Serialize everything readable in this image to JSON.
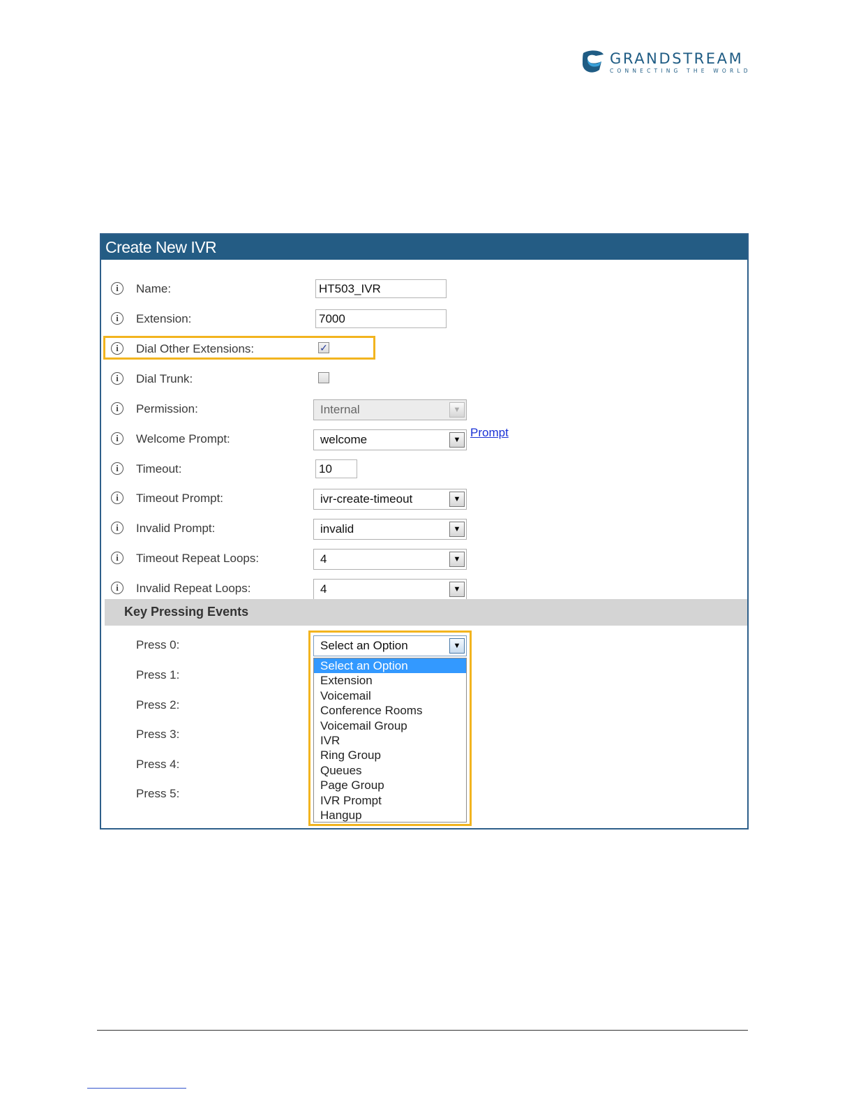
{
  "brand": {
    "name": "GRANDSTREAM",
    "tagline": "CONNECTING THE WORLD",
    "colors": {
      "primary": "#1f5c84",
      "accent": "#3aa0d8"
    }
  },
  "panel": {
    "title": "Create New IVR",
    "header_color": "#245c84",
    "highlight_color": "#f2b41f"
  },
  "fields": {
    "name": {
      "label": "Name:",
      "value": "HT503_IVR"
    },
    "extension": {
      "label": "Extension:",
      "value": "7000"
    },
    "dial_other_extensions": {
      "label": "Dial Other Extensions:",
      "checked": true,
      "mark": "✓"
    },
    "dial_trunk": {
      "label": "Dial Trunk:",
      "checked": false
    },
    "permission": {
      "label": "Permission:",
      "value": "Internal",
      "disabled": true
    },
    "welcome_prompt": {
      "label": "Welcome Prompt:",
      "value": "welcome",
      "link": "Prompt"
    },
    "timeout": {
      "label": "Timeout:",
      "value": "10"
    },
    "timeout_prompt": {
      "label": "Timeout Prompt:",
      "value": "ivr-create-timeout"
    },
    "invalid_prompt": {
      "label": "Invalid Prompt:",
      "value": "invalid"
    },
    "timeout_repeat_loops": {
      "label": "Timeout Repeat Loops:",
      "value": "4"
    },
    "invalid_repeat_loops": {
      "label": "Invalid Repeat Loops:",
      "value": "4"
    }
  },
  "key_events": {
    "title": "Key Pressing Events",
    "press_labels": [
      "Press 0:",
      "Press 1:",
      "Press 2:",
      "Press 3:",
      "Press 4:",
      "Press 5:"
    ],
    "press0_value": "Select an Option",
    "dropdown_options": [
      "Select an Option",
      "Extension",
      "Voicemail",
      "Conference Rooms",
      "Voicemail Group",
      "IVR",
      "Ring Group",
      "Queues",
      "Page Group",
      "IVR Prompt",
      "Hangup"
    ],
    "selected_option": "Select an Option"
  }
}
